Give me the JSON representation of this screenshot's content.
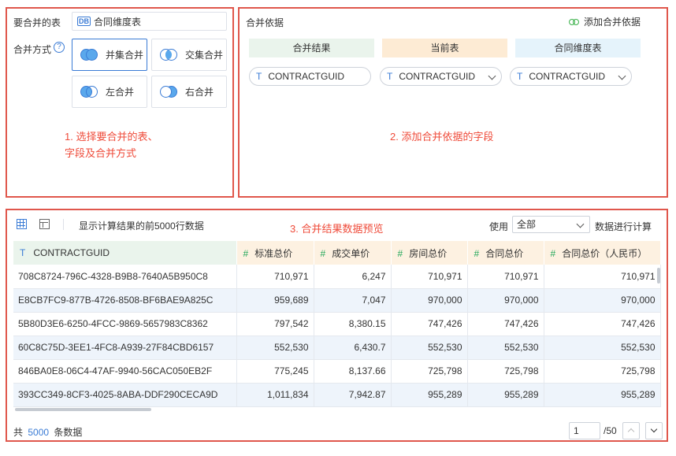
{
  "merge_setup": {
    "table_label": "要合并的表",
    "table_icon": "DB",
    "table_value": "合同维度表",
    "mode_label": "合并方式",
    "help_glyph": "?",
    "modes": [
      {
        "label": "并集合并",
        "selected": true
      },
      {
        "label": "交集合并",
        "selected": false
      },
      {
        "label": "左合并",
        "selected": false
      },
      {
        "label": "右合并",
        "selected": false
      }
    ],
    "annotation_line1": "1. 选择要合并的表、",
    "annotation_line2": "字段及合并方式"
  },
  "merge_basis": {
    "title": "合并依据",
    "add_button": "添加合并依据",
    "columns": [
      {
        "label": "合并结果",
        "bg": "#eaf4ec"
      },
      {
        "label": "当前表",
        "bg": "#fdebd4"
      },
      {
        "label": "合同维度表",
        "bg": "#e5f3fb"
      }
    ],
    "field_type_icon": "T",
    "fields": [
      "CONTRACTGUID",
      "CONTRACTGUID",
      "CONTRACTGUID"
    ],
    "annotation": "2. 添加合并依据的字段"
  },
  "preview": {
    "toolbar_text": "显示计算结果的前5000行数据",
    "annotation": "3. 合并结果数据预览",
    "use_label": "使用",
    "scope_value": "全部",
    "compute_label": "数据进行计算",
    "headers": [
      {
        "type": "T",
        "label": "CONTRACTGUID"
      },
      {
        "type": "#",
        "label": "标准总价"
      },
      {
        "type": "#",
        "label": "成交单价"
      },
      {
        "type": "#",
        "label": "房间总价"
      },
      {
        "type": "#",
        "label": "合同总价"
      },
      {
        "type": "#",
        "label": "合同总价（人民币）"
      }
    ],
    "rows": [
      [
        "708C8724-796C-4328-B9B8-7640A5B950C8",
        "710,971",
        "6,247",
        "710,971",
        "710,971",
        "710,971"
      ],
      [
        "E8CB7FC9-877B-4726-8508-BF6BAE9A825C",
        "959,689",
        "7,047",
        "970,000",
        "970,000",
        "970,000"
      ],
      [
        "5B80D3E6-6250-4FCC-9869-5657983C8362",
        "797,542",
        "8,380.15",
        "747,426",
        "747,426",
        "747,426"
      ],
      [
        "60C8C75D-3EE1-4FC8-A939-27F84CBD6157",
        "552,530",
        "6,430.7",
        "552,530",
        "552,530",
        "552,530"
      ],
      [
        "846BA0E8-06C4-47AF-9940-56CAC050EB2F",
        "775,245",
        "8,137.66",
        "725,798",
        "725,798",
        "725,798"
      ],
      [
        "393CC349-8CF3-4025-8ABA-DDF290CECA9D",
        "1,011,834",
        "7,942.87",
        "955,289",
        "955,289",
        "955,289"
      ]
    ],
    "footer_prefix": "共",
    "total_count": "5000",
    "footer_suffix": "条数据",
    "current_page": "1",
    "total_pages": "/50"
  }
}
